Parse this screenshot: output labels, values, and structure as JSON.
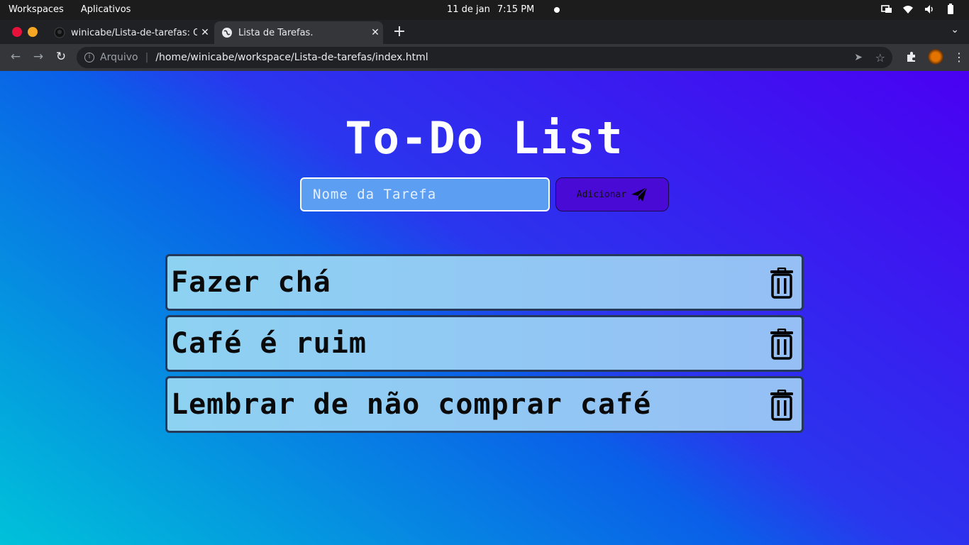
{
  "system_bar": {
    "workspaces": "Workspaces",
    "apps": "Aplicativos",
    "date": "11 de jan",
    "time": "7:15 PM"
  },
  "browser": {
    "tabs": [
      {
        "title": "winicabe/Lista-de-tarefas: O c",
        "icon": "github-icon"
      },
      {
        "title": "Lista de Tarefas.",
        "icon": "globe-icon"
      }
    ],
    "address": {
      "scheme_label": "Arquivo",
      "separator": "|",
      "url": "/home/winicabe/workspace/Lista-de-tarefas/index.html"
    }
  },
  "page": {
    "title": "To-Do List",
    "input_placeholder": "Nome da Tarefa",
    "add_button_label": "Adicionar",
    "tasks": [
      {
        "text": "Fazer chá"
      },
      {
        "text": "Café é ruim"
      },
      {
        "text": "Lembrar de não comprar café"
      }
    ]
  },
  "colors": {
    "gradient_start": "#00c2d9",
    "gradient_end": "#4a00f2",
    "button_bg": "#4a0ad6",
    "task_bg": "#8ed2f2"
  }
}
